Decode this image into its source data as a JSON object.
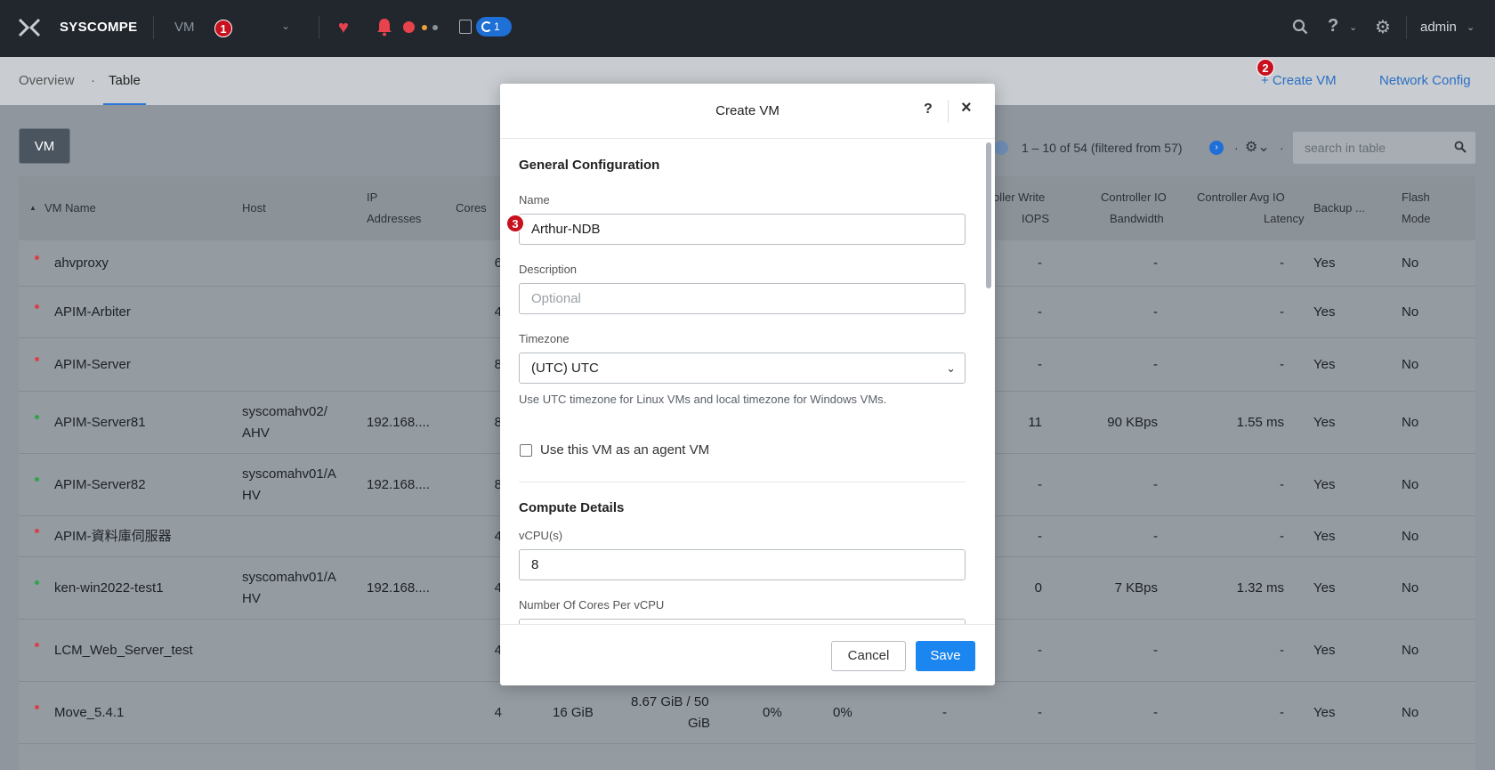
{
  "topbar": {
    "brand": "SYSCOMPE",
    "module": "VM",
    "module_chevron": "⌄",
    "task_count": "1",
    "user": "admin",
    "help_symbol": "?",
    "chevron": "⌄",
    "icons": [
      "logo-icon",
      "heart-icon",
      "bell-icon",
      "tasks-icon",
      "search-icon",
      "help-icon",
      "gear-icon"
    ]
  },
  "annotations": {
    "one": "1",
    "two": "2",
    "three": "3"
  },
  "subnav": {
    "tab_overview": "Overview",
    "dot_sep": "·",
    "tab_table": "Table",
    "create_vm": "+ Create VM",
    "network_config": "Network Config"
  },
  "toolbar": {
    "vm_button": "VM",
    "pagination": "1 – 10 of 54 (filtered from 57)",
    "pager_sep": "·",
    "search_placeholder": "search in table"
  },
  "table": {
    "headers": {
      "vm_name": "VM Name",
      "host": "Host",
      "ip_1": "IP",
      "ip_2": "Addresses",
      "cores": "Cores",
      "ctrl_write_1": "oller Write",
      "ctrl_write_2": "IOPS",
      "ctrl_io_1": "Controller IO",
      "ctrl_io_2": "Bandwidth",
      "ctrl_lat_1": "Controller Avg IO",
      "ctrl_lat_2": "Latency",
      "backup": "Backup ...",
      "flash_1": "Flash",
      "flash_2": "Mode"
    },
    "rows": [
      {
        "name": "ahvproxy",
        "host1": "",
        "host2": "",
        "ip": "",
        "cores": "6",
        "write": "-",
        "bw": "-",
        "lat": "-",
        "backup": "Yes",
        "flash": "No",
        "status": "red"
      },
      {
        "name": "APIM-Arbiter",
        "host1": "",
        "host2": "",
        "ip": "",
        "cores": "4",
        "write": "-",
        "bw": "-",
        "lat": "-",
        "backup": "Yes",
        "flash": "No",
        "status": "red"
      },
      {
        "name": "APIM-Server",
        "host1": "",
        "host2": "",
        "ip": "",
        "cores": "8",
        "write": "-",
        "bw": "-",
        "lat": "-",
        "backup": "Yes",
        "flash": "No",
        "status": "red"
      },
      {
        "name": "APIM-Server81",
        "host1": "syscomahv02/",
        "host2": "AHV",
        "ip": "192.168....",
        "cores": "8",
        "write": "11",
        "bw": "90 KBps",
        "lat": "1.55 ms",
        "backup": "Yes",
        "flash": "No",
        "status": "green"
      },
      {
        "name": "APIM-Server82",
        "host1": "syscomahv01/A",
        "host2": "HV",
        "ip": "192.168....",
        "cores": "8",
        "write": "-",
        "bw": "-",
        "lat": "-",
        "backup": "Yes",
        "flash": "No",
        "status": "green"
      },
      {
        "name": "APIM-資料庫伺服器",
        "host1": "",
        "host2": "",
        "ip": "",
        "cores": "4",
        "write": "-",
        "bw": "-",
        "lat": "-",
        "backup": "Yes",
        "flash": "No",
        "status": "red"
      },
      {
        "name": "ken-win2022-test1",
        "host1": "syscomahv01/A",
        "host2": "HV",
        "ip": "192.168....",
        "cores": "4",
        "write": "0",
        "bw": "7 KBps",
        "lat": "1.32 ms",
        "backup": "Yes",
        "flash": "No",
        "status": "green"
      },
      {
        "name": "LCM_Web_Server_test",
        "host1": "",
        "host2": "",
        "ip": "",
        "cores": "4",
        "write": "-",
        "bw": "-",
        "lat": "-",
        "backup": "Yes",
        "flash": "No",
        "status": "red"
      },
      {
        "name": "Move_5.4.1",
        "host1": "",
        "host2": "",
        "ip": "",
        "cores": "4",
        "write": "-",
        "bw": "-",
        "lat": "-",
        "backup": "Yes",
        "flash": "No",
        "status": "red"
      }
    ],
    "move_extra": {
      "memory": "16 GiB",
      "storage_1": "8.67 GiB / 50",
      "storage_2": "GiB",
      "cpu": "0%",
      "mem_usage": "0%",
      "read_iops": "-"
    }
  },
  "modal": {
    "title": "Create VM",
    "help": "?",
    "close": "×",
    "general_title": "General Configuration",
    "name_label": "Name",
    "name_value": "Arthur-NDB",
    "description_label": "Description",
    "description_placeholder": "Optional",
    "timezone_label": "Timezone",
    "timezone_value": "(UTC) UTC",
    "timezone_chevron": "⌄",
    "timezone_hint": "Use UTC timezone for Linux VMs and local timezone for Windows VMs.",
    "agent_label": "Use this VM as an agent VM",
    "compute_title": "Compute Details",
    "vcpu_label": "vCPU(s)",
    "vcpu_value": "8",
    "cores_label": "Number Of Cores Per vCPU",
    "cancel": "Cancel",
    "save": "Save"
  },
  "colors": {
    "accent": "#1b85f0",
    "status_red": "#d9424c",
    "status_green": "#2fa44f",
    "badge": "#c8101e"
  }
}
